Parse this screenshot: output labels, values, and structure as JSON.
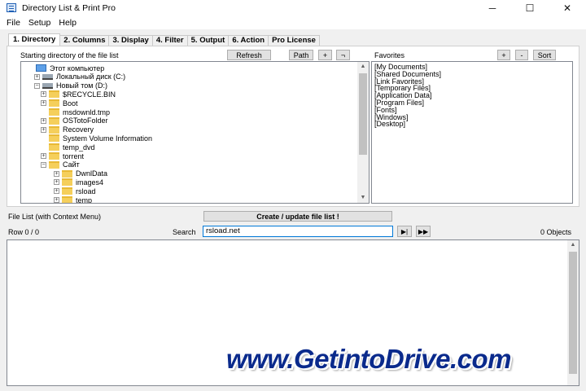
{
  "window": {
    "title": "Directory List & Print Pro",
    "minimize": "─",
    "maximize": "☐",
    "close": "✕"
  },
  "menu": [
    "File",
    "Setup",
    "Help"
  ],
  "tabs": [
    "1. Directory",
    "2. Columns",
    "3. Display",
    "4. Filter",
    "5. Output",
    "6. Action",
    "Pro License"
  ],
  "directory": {
    "start_label": "Starting directory of the file list",
    "refresh": "Refresh",
    "path": "Path",
    "plus": "+",
    "arrow": "¬",
    "tree": [
      {
        "label": "Этот компьютер",
        "icon": "computer-icon",
        "level": 0,
        "expander": ""
      },
      {
        "label": "Локальный диск (C:)",
        "icon": "drive-icon",
        "level": 1,
        "expander": "+"
      },
      {
        "label": "Новый том (D:)",
        "icon": "drive-icon",
        "level": 1,
        "expander": "−"
      },
      {
        "label": "$RECYCLE.BIN",
        "icon": "folder-icon",
        "level": 2,
        "expander": "+"
      },
      {
        "label": "Boot",
        "icon": "folder-icon",
        "level": 2,
        "expander": "+"
      },
      {
        "label": "msdownld.tmp",
        "icon": "folder-icon",
        "level": 2,
        "expander": ""
      },
      {
        "label": "OSTotoFolder",
        "icon": "folder-icon",
        "level": 2,
        "expander": "+"
      },
      {
        "label": "Recovery",
        "icon": "folder-icon",
        "level": 2,
        "expander": "+"
      },
      {
        "label": "System Volume Information",
        "icon": "folder-icon",
        "level": 2,
        "expander": ""
      },
      {
        "label": "temp_dvd",
        "icon": "folder-icon",
        "level": 2,
        "expander": ""
      },
      {
        "label": "torrent",
        "icon": "folder-icon",
        "level": 2,
        "expander": "+"
      },
      {
        "label": "Сайт",
        "icon": "folder-icon",
        "level": 2,
        "expander": "−"
      },
      {
        "label": "DwnlData",
        "icon": "folder-icon",
        "level": 3,
        "expander": "+"
      },
      {
        "label": "images4",
        "icon": "folder-icon",
        "level": 3,
        "expander": "+"
      },
      {
        "label": "rsload",
        "icon": "folder-icon",
        "level": 3,
        "expander": "+"
      },
      {
        "label": "temp",
        "icon": "folder-icon",
        "level": 3,
        "expander": "+"
      }
    ]
  },
  "favorites": {
    "label": "Favorites",
    "plus": "+",
    "minus": "-",
    "sort": "Sort",
    "items": [
      "[My Documents]",
      "[Shared Documents]",
      "[Link Favorites]",
      "[Temporary Files]",
      "[Application Data]",
      "[Program Files]",
      "[Fonts]",
      "[Windows]",
      "[Desktop]"
    ]
  },
  "filelist": {
    "label": "File List (with Context Menu)",
    "create_button": "Create / update file list !",
    "row_status": "Row 0 / 0",
    "search_label": "Search",
    "search_value": "rsload.net",
    "objects": "0 Objects",
    "play_icon": "▶|",
    "ffwd_icon": "▶▶"
  },
  "watermark": "www.GetintoDrive.com",
  "colors": {
    "accent": "#0078d7",
    "folder": "#f5cf5b",
    "watermark": "#0a2a8c"
  }
}
